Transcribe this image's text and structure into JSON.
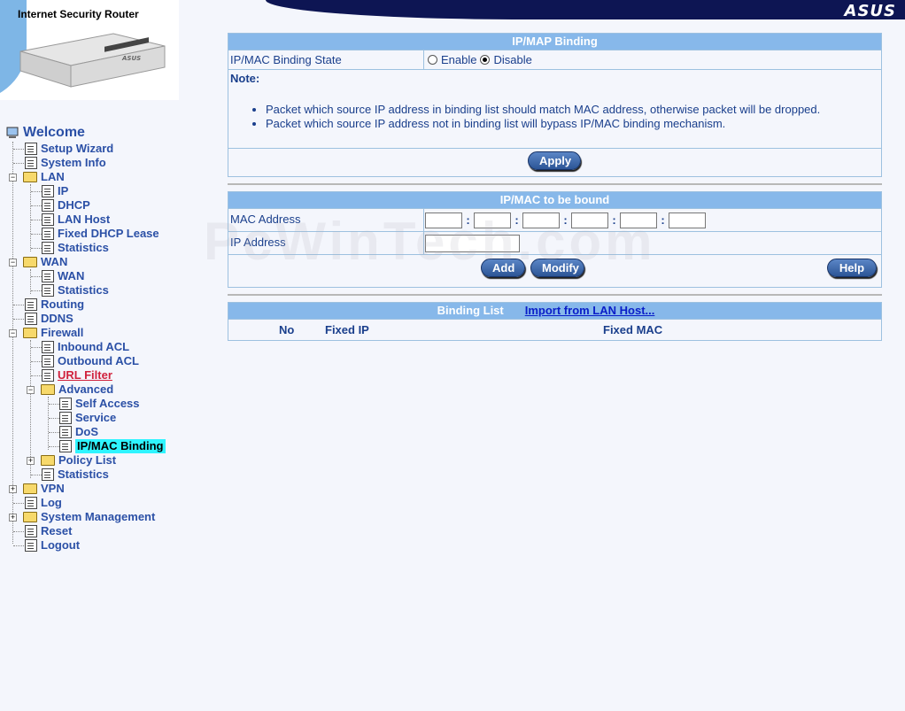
{
  "header": {
    "brand": "ASUS",
    "product_title": "Internet Security Router",
    "device_label": "ASUS"
  },
  "watermark": "PcWinTech.com",
  "tree": {
    "welcome": "Welcome",
    "setup_wizard": "Setup Wizard",
    "system_info": "System Info",
    "lan": "LAN",
    "lan_ip": "IP",
    "lan_dhcp": "DHCP",
    "lan_host": "LAN Host",
    "fixed_dhcp": "Fixed DHCP Lease",
    "lan_stats": "Statistics",
    "wan": "WAN",
    "wan_wan": "WAN",
    "wan_stats": "Statistics",
    "routing": "Routing",
    "ddns": "DDNS",
    "firewall": "Firewall",
    "inbound_acl": "Inbound ACL",
    "outbound_acl": "Outbound ACL",
    "url_filter": "URL Filter",
    "advanced": "Advanced",
    "self_access": "Self Access",
    "service": "Service",
    "dos": "DoS",
    "ipmac_binding": "IP/MAC Binding",
    "policy_list": "Policy List",
    "fw_stats": "Statistics",
    "vpn": "VPN",
    "log": "Log",
    "sys_mgmt": "System Management",
    "reset": "Reset",
    "logout": "Logout"
  },
  "binding_panel": {
    "title": "IP/MAP Binding",
    "state_label": "IP/MAC Binding State",
    "enable_label": "Enable",
    "disable_label": "Disable",
    "selected": "Disable",
    "note_label": "Note:",
    "notes": [
      "Packet which source IP address in binding list should match MAC address, otherwise packet will be dropped.",
      "Packet which source IP address not in binding list will bypass IP/MAC binding mechanism."
    ],
    "apply_label": "Apply"
  },
  "bound_panel": {
    "title": "IP/MAC to be bound",
    "mac_label": "MAC Address",
    "ip_label": "IP Address",
    "mac_sep": ":",
    "add_label": "Add",
    "modify_label": "Modify",
    "help_label": "Help"
  },
  "list_panel": {
    "title": "Binding List",
    "import_link": "Import from LAN Host...",
    "col_no": "No",
    "col_ip": "Fixed IP",
    "col_mac": "Fixed MAC"
  }
}
